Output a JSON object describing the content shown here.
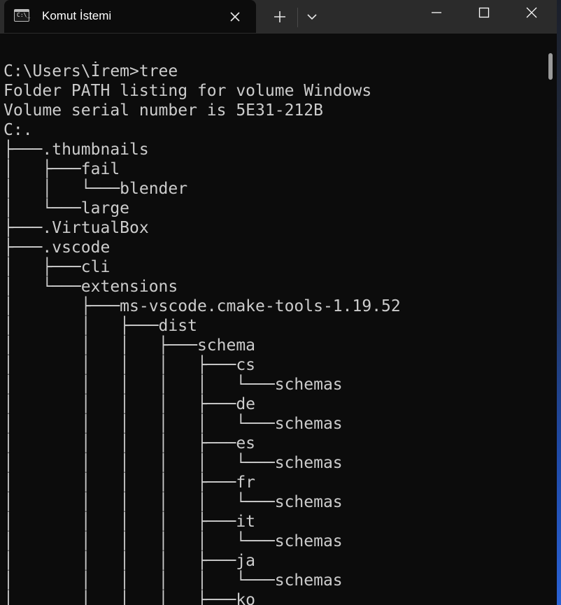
{
  "window": {
    "tab_title": "Komut İstemi",
    "icon": "cmd-console-icon",
    "tab_icon_glyph": "C:\\_"
  },
  "controls": {
    "tab_close": "close-icon",
    "new_tab": "plus-icon",
    "dropdown": "chevron-down-icon",
    "minimize": "minimize-icon",
    "maximize": "maximize-icon",
    "close": "close-icon"
  },
  "colors": {
    "terminal_bg": "#0c0c0c",
    "titlebar_bg": "#2b2b2b",
    "text": "#cccccc"
  },
  "terminal": {
    "lines": [
      "C:\\Users\\İrem>tree",
      "Folder PATH listing for volume Windows",
      "Volume serial number is 5E31-212B",
      "C:.",
      "├───.thumbnails",
      "│   ├───fail",
      "│   │   └───blender",
      "│   └───large",
      "├───.VirtualBox",
      "├───.vscode",
      "│   ├───cli",
      "│   └───extensions",
      "│       ├───ms-vscode.cmake-tools-1.19.52",
      "│       │   ├───dist",
      "│       │   │   ├───schema",
      "│       │   │   │   ├───cs",
      "│       │   │   │   │   └───schemas",
      "│       │   │   │   ├───de",
      "│       │   │   │   │   └───schemas",
      "│       │   │   │   ├───es",
      "│       │   │   │   │   └───schemas",
      "│       │   │   │   ├───fr",
      "│       │   │   │   │   └───schemas",
      "│       │   │   │   ├───it",
      "│       │   │   │   │   └───schemas",
      "│       │   │   │   ├───ja",
      "│       │   │   │   │   └───schemas",
      "│       │   │   │   ├───ko"
    ]
  }
}
